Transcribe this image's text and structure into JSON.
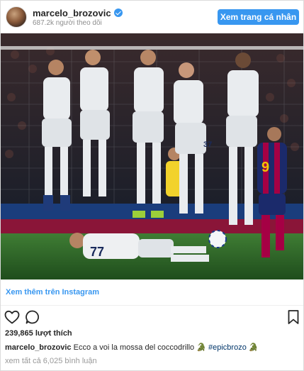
{
  "header": {
    "username": "marcelo_brozovic",
    "followers": "687.2k người theo dõi",
    "profile_button": "Xem trang cá nhân"
  },
  "post": {
    "photo_alt": "",
    "view_more": "Xem thêm trên Instagram",
    "likes": "239,865 lượt thích",
    "caption_user": "marcelo_brozovic",
    "caption_text": " Ecco a voi la mossa del coccodrillo ",
    "caption_emoji1": "🐊",
    "caption_hashtag": "#epicbrozo",
    "caption_emoji2": "🐊",
    "view_comments": "xem tất cả 6,025 bình luận"
  },
  "colors": {
    "accent": "#3897f0",
    "inter_kit": "#e9ecef",
    "barca_blue": "#1b2a6b",
    "barca_red": "#a50044",
    "pitch": "#2f6b2a"
  },
  "icons": [
    "verified-badge-icon",
    "heart-icon",
    "comment-icon",
    "bookmark-icon"
  ]
}
